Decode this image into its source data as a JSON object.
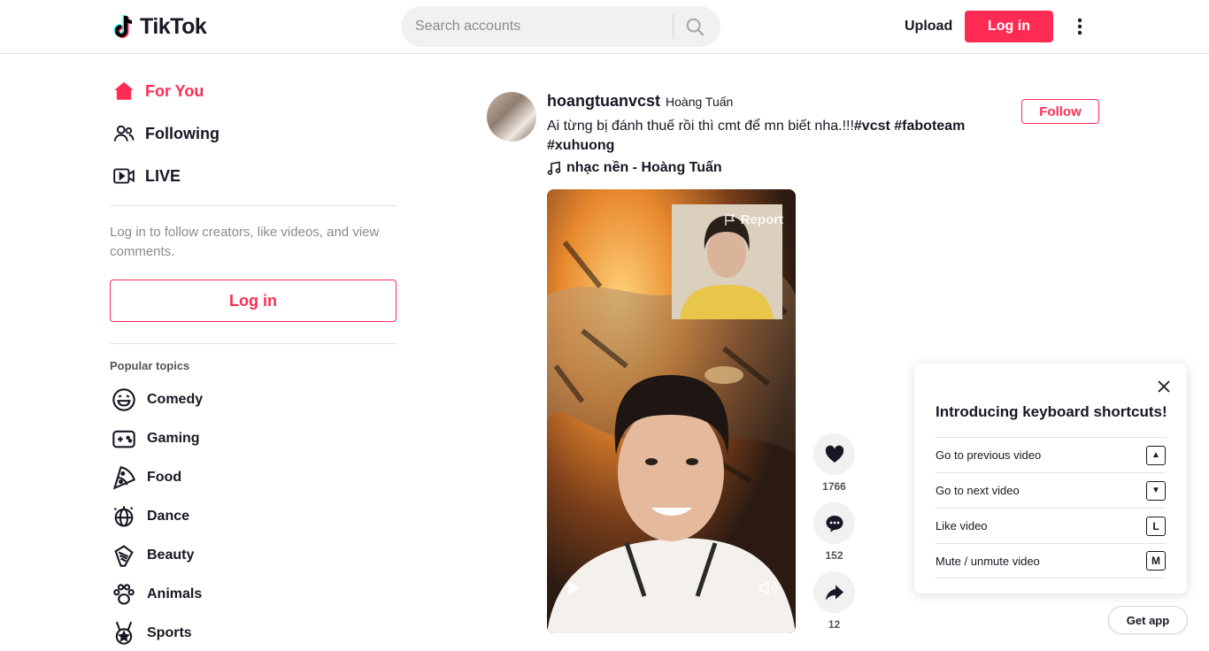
{
  "header": {
    "logo_text": "TikTok",
    "search_placeholder": "Search accounts",
    "upload_label": "Upload",
    "login_label": "Log in"
  },
  "sidebar": {
    "nav": [
      {
        "label": "For You",
        "icon": "home-icon",
        "active": true
      },
      {
        "label": "Following",
        "icon": "people-icon",
        "active": false
      },
      {
        "label": "LIVE",
        "icon": "live-icon",
        "active": false
      }
    ],
    "login_prompt": "Log in to follow creators, like videos, and view comments.",
    "login_label": "Log in",
    "topics_title": "Popular topics",
    "topics": [
      {
        "label": "Comedy",
        "icon": "comedy-icon"
      },
      {
        "label": "Gaming",
        "icon": "gaming-icon"
      },
      {
        "label": "Food",
        "icon": "food-icon"
      },
      {
        "label": "Dance",
        "icon": "dance-icon"
      },
      {
        "label": "Beauty",
        "icon": "beauty-icon"
      },
      {
        "label": "Animals",
        "icon": "animals-icon"
      },
      {
        "label": "Sports",
        "icon": "sports-icon"
      }
    ]
  },
  "post": {
    "author_id": "hoangtuanvcst",
    "author_nickname": "Hoàng Tuấn",
    "follow_label": "Follow",
    "caption_text": "Ai từng bị đánh thuế rồi thì cmt để mn biết nha.!!!",
    "hashtags": [
      "#vcst",
      "#faboteam",
      "#xuhuong"
    ],
    "music": "nhạc nền - Hoàng Tuấn",
    "report_label": "Report",
    "likes": "1766",
    "comments": "152",
    "shares": "12"
  },
  "shortcuts": {
    "title": "Introducing keyboard shortcuts!",
    "items": [
      {
        "label": "Go to previous video",
        "key": "▲"
      },
      {
        "label": "Go to next video",
        "key": "▼"
      },
      {
        "label": "Like video",
        "key": "L"
      },
      {
        "label": "Mute / unmute video",
        "key": "M"
      }
    ]
  },
  "get_app_label": "Get app",
  "colors": {
    "brand_red": "#fe2c55",
    "text": "#161823",
    "muted": "#8a8b91"
  }
}
